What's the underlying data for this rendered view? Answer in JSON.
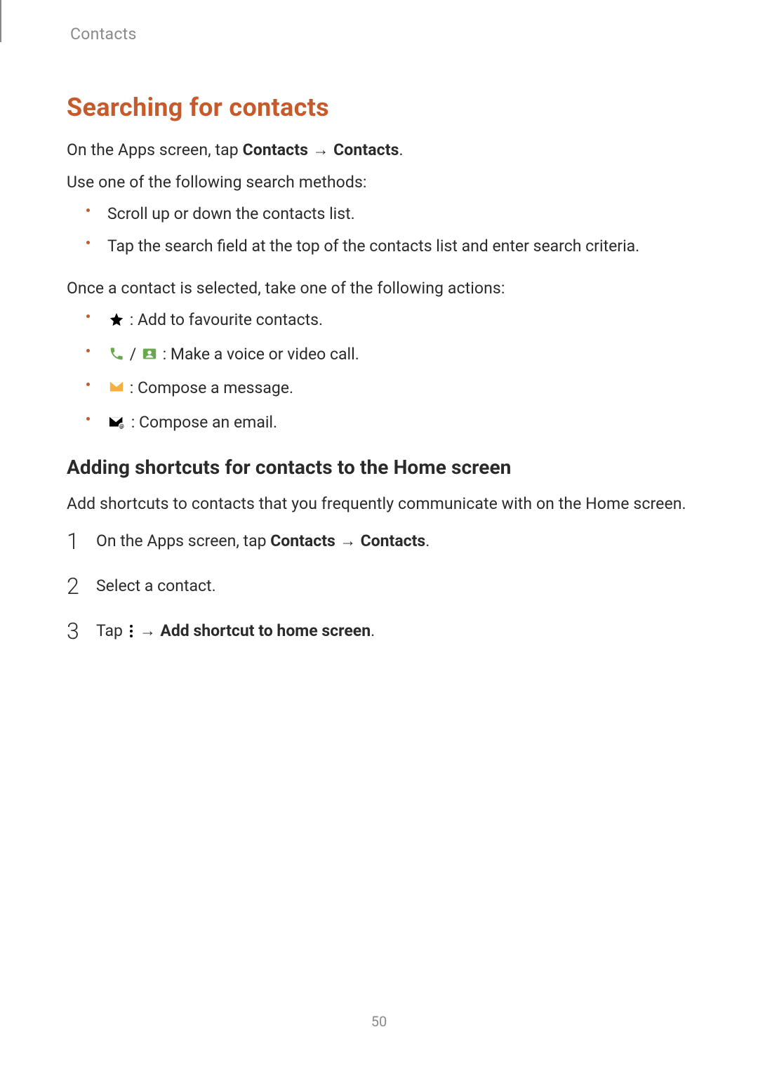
{
  "header": "Contacts",
  "pageNumber": "50",
  "section": {
    "title": "Searching for contacts",
    "intro1_prefix": "On the Apps screen, tap ",
    "intro1_bold1": "Contacts",
    "intro1_arrow": " → ",
    "intro1_bold2": "Contacts",
    "intro1_suffix": ".",
    "intro2": "Use one of the following search methods:",
    "methods": [
      "Scroll up or down the contacts list.",
      "Tap the search field at the top of the contacts list and enter search criteria."
    ],
    "actionsIntro": "Once a contact is selected, take one of the following actions:",
    "actions": {
      "fav": " : Add to favourite contacts.",
      "call_sep": " / ",
      "call_suffix": " : Make a voice or video call.",
      "msg": " : Compose a message.",
      "email": " : Compose an email."
    },
    "subheading": "Adding shortcuts for contacts to the Home screen",
    "subIntro": "Add shortcuts to contacts that you frequently communicate with on the Home screen.",
    "steps": {
      "s1_prefix": "On the Apps screen, tap ",
      "s1_bold1": "Contacts",
      "s1_arrow": " → ",
      "s1_bold2": "Contacts",
      "s1_suffix": ".",
      "s2": "Select a contact.",
      "s3_prefix": "Tap ",
      "s3_arrow": " → ",
      "s3_bold": "Add shortcut to home screen",
      "s3_suffix": "."
    }
  }
}
